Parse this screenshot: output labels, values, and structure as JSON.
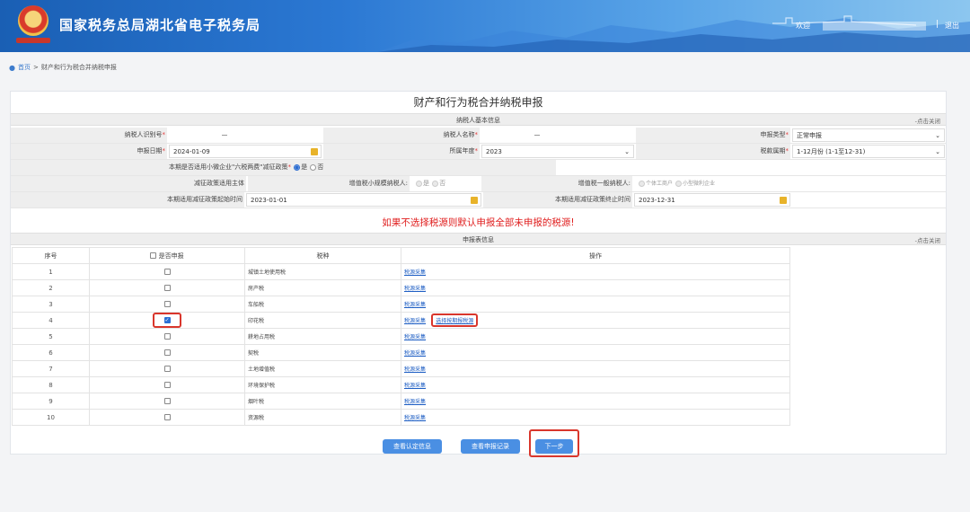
{
  "header": {
    "site_title": "国家税务总局湖北省电子税务局",
    "welcome": "欢迎",
    "separator": "|",
    "logout": "退出"
  },
  "breadcrumb": {
    "home": "首页",
    "sep": ">",
    "current": "财产和行为税合并纳税申报"
  },
  "page": {
    "title": "财产和行为税合并纳税申报"
  },
  "basic": {
    "section_title": "纳税人基本信息",
    "toggle": "-点击关闭",
    "taxpayer_id_label": "纳税人识别号",
    "taxpayer_name_label": "纳税人名称",
    "decl_type_label": "申报类型",
    "decl_type_value": "正常申报",
    "decl_date_label": "申报日期",
    "decl_date_value": "2024-01-09",
    "year_label": "所属年度",
    "year_value": "2023",
    "period_label": "税款属期",
    "period_value": "1-12月份 (1-1至12-31)",
    "small_policy_label": "本期是否适用小微企业\"六税两费\"减征政策",
    "yes": "是",
    "no": "否",
    "subject_label": "减征政策适用主体",
    "vat_small_label": "增值税小规模纳税人:",
    "vat_general_label": "增值税一般纳税人:",
    "individual": "个体工商户",
    "small_micro": "小型微利企业",
    "start_label": "本期适用减征政策起始时间",
    "start_value": "2023-01-01",
    "end_label": "本期适用减征政策终止时间",
    "end_value": "2023-12-31",
    "required_mark": "*"
  },
  "warning": "如果不选择税源则默认申报全部未申报的税源!",
  "table": {
    "section_title": "申报表信息",
    "toggle": "-点击关闭",
    "headers": {
      "no": "序号",
      "declare": "是否申报",
      "tax": "税种",
      "op": "操作"
    },
    "rows": [
      {
        "no": "1",
        "tax": "城镇土地使用税",
        "op": "税源采集",
        "checked": false
      },
      {
        "no": "2",
        "tax": "房产税",
        "op": "税源采集",
        "checked": false
      },
      {
        "no": "3",
        "tax": "车船税",
        "op": "税源采集",
        "checked": false
      },
      {
        "no": "4",
        "tax": "印花税",
        "op": "税源采集",
        "op2": "选择按期报税源",
        "checked": true
      },
      {
        "no": "5",
        "tax": "耕地占用税",
        "op": "税源采集",
        "checked": false
      },
      {
        "no": "6",
        "tax": "契税",
        "op": "税源采集",
        "checked": false
      },
      {
        "no": "7",
        "tax": "土地增值税",
        "op": "税源采集",
        "checked": false
      },
      {
        "no": "8",
        "tax": "环境保护税",
        "op": "税源采集",
        "checked": false
      },
      {
        "no": "9",
        "tax": "烟叶税",
        "op": "税源采集",
        "checked": false
      },
      {
        "no": "10",
        "tax": "资源税",
        "op": "税源采集",
        "checked": false
      }
    ]
  },
  "buttons": {
    "view_cert": "查看认定信息",
    "view_records": "查看申报记录",
    "next": "下一步"
  }
}
